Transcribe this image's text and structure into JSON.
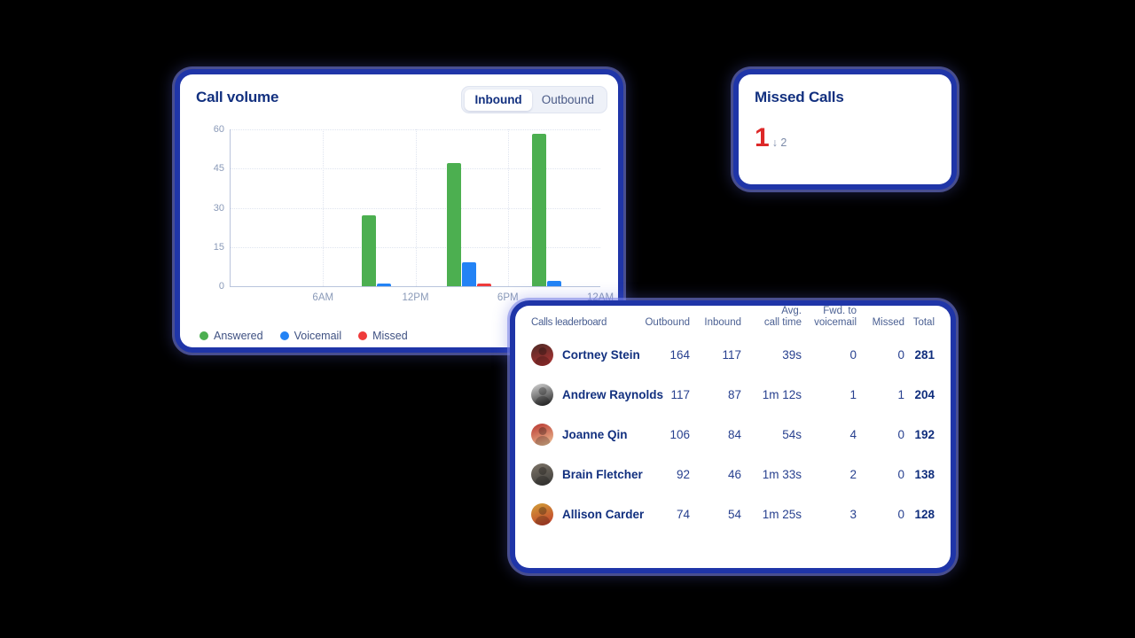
{
  "call_volume": {
    "title": "Call volume",
    "toggle": {
      "options": [
        "Inbound",
        "Outbound"
      ],
      "selected": "Inbound"
    },
    "legend": [
      {
        "label": "Answered",
        "color": "#4caf50"
      },
      {
        "label": "Voicemail",
        "color": "#2383f5"
      },
      {
        "label": "Missed",
        "color": "#ef3b3b"
      }
    ]
  },
  "chart_data": {
    "type": "bar",
    "title": "Call volume",
    "xlabel": "",
    "ylabel": "",
    "ylim": [
      0,
      60
    ],
    "yticks": [
      0,
      15,
      30,
      45,
      60
    ],
    "xticks": [
      "6AM",
      "12PM",
      "6PM",
      "12AM"
    ],
    "grid": true,
    "legend_position": "bottom-left",
    "x": [
      "8AM",
      "2PM",
      "8PM"
    ],
    "series": [
      {
        "name": "Answered",
        "color": "#4caf50",
        "values": [
          27,
          47,
          58
        ]
      },
      {
        "name": "Voicemail",
        "color": "#2383f5",
        "values": [
          1,
          9,
          2
        ]
      },
      {
        "name": "Missed",
        "color": "#ef3b3b",
        "values": [
          0,
          1,
          0
        ]
      }
    ]
  },
  "missed_calls": {
    "title": "Missed Calls",
    "value": "1",
    "delta": "↓ 2",
    "value_color": "#dd2828"
  },
  "leaderboard": {
    "title": "Calls leaderboard",
    "columns": [
      "Outbound",
      "Inbound",
      "Avg. call time",
      "Fwd. to voicemail",
      "Missed",
      "Total"
    ],
    "columns_wrapped": [
      {
        "line1": "",
        "line2": "Outbound"
      },
      {
        "line1": "",
        "line2": "Inbound"
      },
      {
        "line1": "Avg.",
        "line2": "call time"
      },
      {
        "line1": "Fwd. to",
        "line2": "voicemail"
      },
      {
        "line1": "",
        "line2": "Missed"
      },
      {
        "line1": "",
        "line2": "Total"
      }
    ],
    "rows": [
      {
        "name": "Cortney Stein",
        "outbound": "164",
        "inbound": "117",
        "avg_call_time": "39s",
        "fwd_voicemail": "0",
        "missed": "0",
        "total": "281",
        "avatar_colors": [
          "#4e2a25",
          "#b43434"
        ]
      },
      {
        "name": "Andrew Raynolds",
        "outbound": "117",
        "inbound": "87",
        "avg_call_time": "1m 12s",
        "fwd_voicemail": "1",
        "missed": "1",
        "total": "204",
        "avatar_colors": [
          "#d8d8d8",
          "#1c1c1c"
        ]
      },
      {
        "name": "Joanne Qin",
        "outbound": "106",
        "inbound": "84",
        "avg_call_time": "54s",
        "fwd_voicemail": "4",
        "missed": "0",
        "total": "192",
        "avatar_colors": [
          "#b8352f",
          "#f0c79a"
        ]
      },
      {
        "name": "Brain Fletcher",
        "outbound": "92",
        "inbound": "46",
        "avg_call_time": "1m 33s",
        "fwd_voicemail": "2",
        "missed": "0",
        "total": "138",
        "avatar_colors": [
          "#7d7468",
          "#3a3a38"
        ]
      },
      {
        "name": "Allison Carder",
        "outbound": "74",
        "inbound": "54",
        "avg_call_time": "1m 25s",
        "fwd_voicemail": "3",
        "missed": "0",
        "total": "128",
        "avatar_colors": [
          "#d2a038",
          "#c03a2b"
        ]
      }
    ],
    "missed_highlight_row": 1
  }
}
